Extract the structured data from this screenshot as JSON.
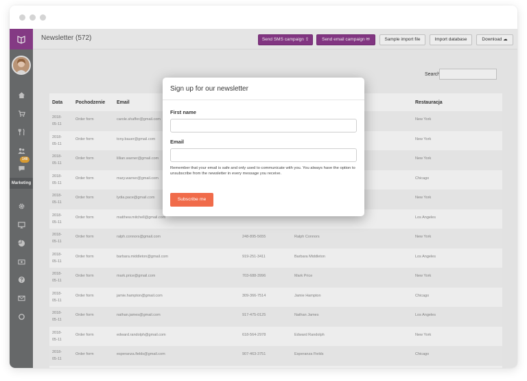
{
  "header": {
    "title": "Newsletter (572)",
    "buttons": [
      {
        "label": "Send SMS campaign ⇪"
      },
      {
        "label": "Send email campaign ✉"
      },
      {
        "label": "Sample import file"
      },
      {
        "label": "Import database"
      },
      {
        "label": "Download ☁"
      }
    ]
  },
  "sidebar": {
    "badge": "148",
    "section_label": "Marketing",
    "icons": [
      "home-icon",
      "cart-icon",
      "utensils-icon",
      "users-icon",
      "chat-icon",
      "gear-icon",
      "monitor-icon",
      "pie-chart-icon",
      "money-icon",
      "help-icon",
      "mail-icon",
      "circle-icon"
    ]
  },
  "search": {
    "label": "Search:"
  },
  "table": {
    "columns": {
      "date": "Data",
      "source": "Pochodzenie",
      "email": "Email",
      "restaurant": "Restauracja"
    },
    "rows": [
      {
        "date": "2018-05-11",
        "source": "Order form",
        "email": "carole.shaffer@gmail.com",
        "phone": "",
        "name": "",
        "restaurant": "New York"
      },
      {
        "date": "2018-05-11",
        "source": "Order form",
        "email": "tony.bauer@gmail.com",
        "phone": "",
        "name": "",
        "restaurant": "New York"
      },
      {
        "date": "2018-05-11",
        "source": "Order form",
        "email": "lillian.warner@gmail.com",
        "phone": "",
        "name": "",
        "restaurant": "New York"
      },
      {
        "date": "2018-05-11",
        "source": "Order form",
        "email": "mary.warner@gmail.com",
        "phone": "",
        "name": "",
        "restaurant": "Chicago"
      },
      {
        "date": "2018-05-11",
        "source": "Order form",
        "email": "lydia.pace@gmail.com",
        "phone": "",
        "name": "",
        "restaurant": "New York"
      },
      {
        "date": "2018-05-11",
        "source": "Order form",
        "email": "matthew.mitchell@gmail.com",
        "phone": "",
        "name": "",
        "restaurant": "Los Angeles"
      },
      {
        "date": "2018-05-11",
        "source": "Order form",
        "email": "ralph.connors@gmail.com",
        "phone": "248-895-5655",
        "name": "Ralph Connors",
        "restaurant": "New York"
      },
      {
        "date": "2018-05-11",
        "source": "Order form",
        "email": "barbara.middleton@gmail.com",
        "phone": "919-251-3411",
        "name": "Barbara Middleton",
        "restaurant": "Los Angeles"
      },
      {
        "date": "2018-05-11",
        "source": "Order form",
        "email": "mark.price@gmail.com",
        "phone": "703-688-3996",
        "name": "Mark Price",
        "restaurant": "New York"
      },
      {
        "date": "2018-05-11",
        "source": "Order form",
        "email": "jamie.hampton@gmail.com",
        "phone": "309-366-7514",
        "name": "Jamie Hampton",
        "restaurant": "Chicago"
      },
      {
        "date": "2018-05-11",
        "source": "Order form",
        "email": "nathan.james@gmail.com",
        "phone": "917-475-0125",
        "name": "Nathan James",
        "restaurant": "Los Angeles"
      },
      {
        "date": "2018-05-11",
        "source": "Order form",
        "email": "edward.randolph@gmail.com",
        "phone": "618-564-2978",
        "name": "Edward Randolph",
        "restaurant": "New York"
      },
      {
        "date": "2018-05-11",
        "source": "Order form",
        "email": "esperanza.fields@gmail.com",
        "phone": "907-463-3751",
        "name": "Esperanza Fields",
        "restaurant": "Chicago"
      }
    ]
  },
  "modal": {
    "title": "Sign up for our newsletter",
    "first_name_label": "First name",
    "email_label": "Email",
    "note": "Remember that your email is safe and only used to communicate with you. You always have the option to unsubscribe from the newsletter in every message you receive.",
    "submit_label": "Subscribe me"
  },
  "colors": {
    "brand_purple": "#8b3a8b",
    "subscribe_orange": "#f06b4a",
    "sidebar_gray": "#6e7072",
    "badge_orange": "#e9a634"
  }
}
